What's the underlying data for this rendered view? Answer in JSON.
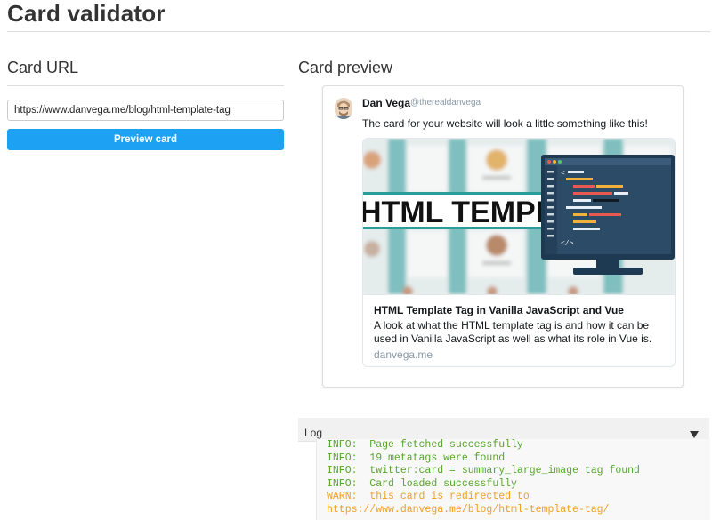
{
  "page": {
    "title": "Card validator"
  },
  "card_url": {
    "heading": "Card URL",
    "input_value": "https://www.danvega.me/blog/html-template-tag",
    "button_label": "Preview card"
  },
  "preview": {
    "heading": "Card preview",
    "tweet": {
      "author_name": "Dan Vega",
      "author_handle": "@therealdanvega",
      "text": "The card for your website will look a little something like this!"
    },
    "card": {
      "image_text": "HTML TEMPLATE",
      "title": "HTML Template Tag in Vanilla JavaScript and Vue",
      "description": "A look at what the HTML template tag is and how it can be used in Vanilla JavaScript as well as what its role in Vue is.",
      "domain": "danvega.me"
    }
  },
  "log": {
    "label": "Log",
    "lines": [
      {
        "level": "info",
        "text": "INFO:  Page fetched successfully"
      },
      {
        "level": "info",
        "text": "INFO:  19 metatags were found"
      },
      {
        "level": "info",
        "text": "INFO:  twitter:card = summary_large_image tag found"
      },
      {
        "level": "info",
        "text": "INFO:  Card loaded successfully"
      },
      {
        "level": "warn",
        "text": "WARN:  this card is redirected to"
      },
      {
        "level": "warn",
        "text": "https://www.danvega.me/blog/html-template-tag/"
      }
    ]
  },
  "colors": {
    "accent": "#1da1f2",
    "info": "#58a62c",
    "warn": "#f0a020"
  }
}
